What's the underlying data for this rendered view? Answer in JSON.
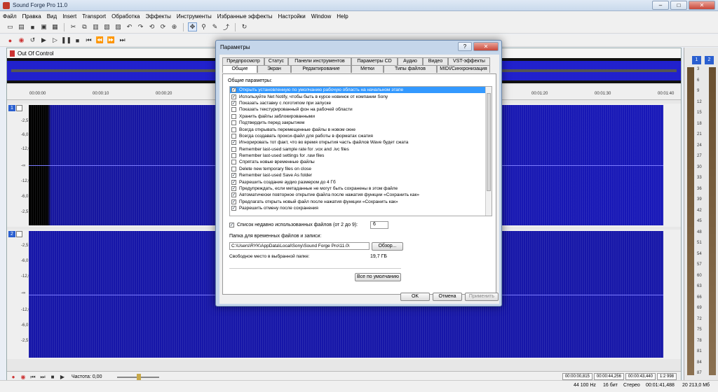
{
  "app": {
    "title": "Sound Forge Pro 11.0",
    "window_controls": [
      "–",
      "□",
      "✕"
    ]
  },
  "menu": [
    "Файл",
    "Правка",
    "Вид",
    "Insert",
    "Transport",
    "Обработка",
    "Эффекты",
    "Инструменты",
    "Избранные эффекты",
    "Настройки",
    "Window",
    "Help"
  ],
  "document": {
    "title": "Out Of Control",
    "ruler_ticks": [
      "00:00:00",
      "00:00:10",
      "00:00:20",
      "00:01:20",
      "00:01:30",
      "00:01:40"
    ],
    "ch1_num": "1",
    "ch2_num": "2",
    "db_labels_ch1": [
      "-2,5",
      "-6,0",
      "-12,0",
      "-∞",
      "-12,0",
      "-6,0",
      "-2,5"
    ],
    "db_labels_ch2": [
      "-2,5",
      "-6,0",
      "-12,0",
      "-∞",
      "-12,0",
      "-6,0",
      "-2,5"
    ],
    "rate_label": "Частота: 0,00",
    "time_cells": [
      "00:00:00,815",
      "00:00:44,256",
      "00:00:43,440",
      "1:2 998"
    ]
  },
  "status": {
    "sample_rate": "44 100 Hz",
    "bits": "16 бит",
    "mode": "Стерео",
    "length": "00:01:41,488",
    "free": "20 213,0 Мб"
  },
  "meter": {
    "btn1": "1",
    "btn2": "2",
    "scale": [
      "3",
      "6",
      "9",
      "12",
      "15",
      "18",
      "21",
      "24",
      "27",
      "30",
      "33",
      "36",
      "39",
      "42",
      "45",
      "48",
      "51",
      "54",
      "57",
      "60",
      "63",
      "66",
      "69",
      "72",
      "75",
      "78",
      "81",
      "84",
      "87"
    ]
  },
  "dialog": {
    "title": "Параметры",
    "help_btn": "?",
    "close_btn": "✕",
    "tabs_row1": [
      "Предпросмотр",
      "Статус",
      "Панели инструментов",
      "Параметры CD",
      "Аудио",
      "Видео",
      "VST-эффекты"
    ],
    "tabs_row2": [
      "Общие",
      "Экран",
      "Редактирование",
      "Метки",
      "Типы файлов",
      "MIDI/Синхронизация"
    ],
    "group_label": "Общие параметры:",
    "options": [
      {
        "label": "Открыть установленную по умолчанию рабочую область на начальном этапе",
        "checked": true
      },
      {
        "label": "Используйте Net Notify, чтобы быть в курсе новинок от компании Sony",
        "checked": true
      },
      {
        "label": "Показать заставку с логотипом при запуске",
        "checked": true
      },
      {
        "label": "Показать текстурированный фон на рабочей области",
        "checked": false
      },
      {
        "label": "Хранить файлы заблокированными",
        "checked": false
      },
      {
        "label": "Подтвердить перед закрытием",
        "checked": false
      },
      {
        "label": "Всегда открывать перемещенные файлы в новом окне",
        "checked": false
      },
      {
        "label": "Всегда создавать прокси-файл для работы в форматах сжатия",
        "checked": false
      },
      {
        "label": "Игнорировать тот факт, что  во время открытия часть  файлов Wave будет сжата",
        "checked": true
      },
      {
        "label": "Remember last-used sample rate for .vox and .ivc files",
        "checked": false
      },
      {
        "label": "Remember last-used settings for .raw files",
        "checked": false
      },
      {
        "label": "Спрятать новые временные файлы",
        "checked": false
      },
      {
        "label": "Delete new temporary files on close",
        "checked": false
      },
      {
        "label": "Remember last-used Save As folder",
        "checked": true
      },
      {
        "label": "Разрешить создание аудио размером до 4 Гб",
        "checked": true
      },
      {
        "label": "Предупреждать, если метаданные не могут быть сохранены в этом файле",
        "checked": true
      },
      {
        "label": "Автоматически повторное открытие файла после нажатия функции «Сохранить как»",
        "checked": true
      },
      {
        "label": "Предлагать открыть новый файл после нажатия функции «Сохранить как»",
        "checked": true
      },
      {
        "label": "Разрешить отмену после сохранения",
        "checked": true
      }
    ],
    "recent_label": "Список недавно использованных файлов (от 2 до 9):",
    "recent_value": "6",
    "temp_label": "Папка для временных файлов и записи:",
    "temp_path": "C:\\Users\\RYK\\AppData\\Local\\Sony\\Sound Forge Pro\\11.0\\",
    "browse_btn": "Обзор...",
    "free_label": "Свободное место в выбранной папке:",
    "free_value": "19,7 ГБ",
    "defaults_btn": "Все по умолчанию",
    "ok_btn": "OK",
    "cancel_btn": "Отмена",
    "apply_btn": "Применить"
  }
}
